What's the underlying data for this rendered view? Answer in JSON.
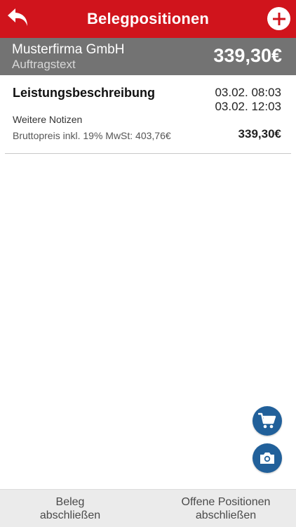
{
  "header": {
    "title": "Belegpositionen",
    "back_icon": "undo-arrow-icon",
    "add_icon": "plus-icon",
    "accent_color": "#d0141c"
  },
  "summary": {
    "company": "Musterfirma GmbH",
    "order_text": "Auftragstext",
    "total": "339,30€"
  },
  "positions": [
    {
      "description": "Leistungsbeschreibung",
      "date_start": "03.02. 08:03",
      "date_end": "03.02. 12:03",
      "notes": "Weitere Notizen",
      "gross_price": "Bruttopreis inkl. 19% MwSt: 403,76€",
      "price": "339,30€"
    }
  ],
  "fabs": {
    "cart_icon": "shopping-cart-icon",
    "camera_icon": "camera-icon",
    "color": "#21609a"
  },
  "footer": {
    "left_line1": "Beleg",
    "left_line2": "abschließen",
    "right_line1": "Offene Positionen",
    "right_line2": "abschließen"
  }
}
